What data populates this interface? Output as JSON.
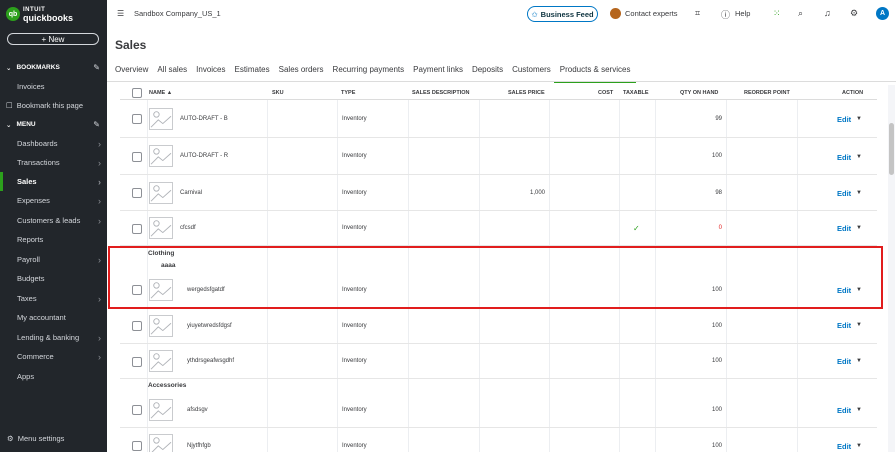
{
  "sidebar": {
    "logo_line1": "INTUIT",
    "logo_line2": "quickbooks",
    "new_label": "+  New",
    "bookmarks_header": "BOOKMARKS",
    "bookmark_items": [
      "Invoices",
      "Bookmark this page"
    ],
    "menu_header": "MENU",
    "menu_items": [
      "Dashboards",
      "Transactions",
      "Sales",
      "Expenses",
      "Customers & leads",
      "Reports",
      "Payroll",
      "Budgets",
      "Taxes",
      "My accountant",
      "Lending & banking",
      "Commerce",
      "Apps"
    ],
    "active_item": "Sales",
    "menu_settings": "Menu settings"
  },
  "topbar": {
    "company": "Sandbox Company_US_1",
    "business_feed": "Business Feed",
    "contact_experts": "Contact experts",
    "help": "Help",
    "user_initial": "A"
  },
  "page": {
    "title": "Sales",
    "tabs": [
      "Overview",
      "All sales",
      "Invoices",
      "Estimates",
      "Sales orders",
      "Recurring payments",
      "Payment links",
      "Deposits",
      "Customers",
      "Products & services"
    ],
    "active_tab": "Products & services"
  },
  "table": {
    "columns": [
      "NAME ▲",
      "SKU",
      "TYPE",
      "SALES DESCRIPTION",
      "SALES PRICE",
      "COST",
      "TAXABLE",
      "QTY ON HAND",
      "REORDER POINT",
      "ACTION"
    ],
    "edit_label": "Edit",
    "rows": [
      {
        "name": "AUTO-DRAFT - B",
        "type": "Inventory",
        "price": "",
        "taxable": "",
        "qty": "99"
      },
      {
        "name": "AUTO-DRAFT - R",
        "type": "Inventory",
        "price": "",
        "taxable": "",
        "qty": "100"
      },
      {
        "name": "Carnival",
        "type": "Inventory",
        "price": "1,000",
        "taxable": "",
        "qty": "98"
      },
      {
        "name": "cfcsdf",
        "type": "Inventory",
        "price": "",
        "taxable": "✓",
        "qty": "0"
      },
      {
        "name": "wergedsfgatdf",
        "type": "Inventory",
        "price": "",
        "taxable": "",
        "qty": "100"
      },
      {
        "name": "yiuyetwredsfdgsf",
        "type": "Inventory",
        "price": "",
        "taxable": "",
        "qty": "100"
      },
      {
        "name": "ythdrsgeafwsgdhf",
        "type": "Inventory",
        "price": "",
        "taxable": "",
        "qty": "100"
      },
      {
        "name": "afsdsgv",
        "type": "Inventory",
        "price": "",
        "taxable": "",
        "qty": "100"
      },
      {
        "name": "Njytfhfgb",
        "type": "Inventory",
        "price": "",
        "taxable": "",
        "qty": "100"
      }
    ],
    "group_clothing": "Clothing",
    "subgroup_aaaa": "aaaa",
    "group_accessories": "Accessories"
  },
  "colors": {
    "accent": "#2ca01c",
    "link": "#0077c5",
    "highlight": "#e11d1d",
    "zero_qty": "#e11d1d"
  }
}
